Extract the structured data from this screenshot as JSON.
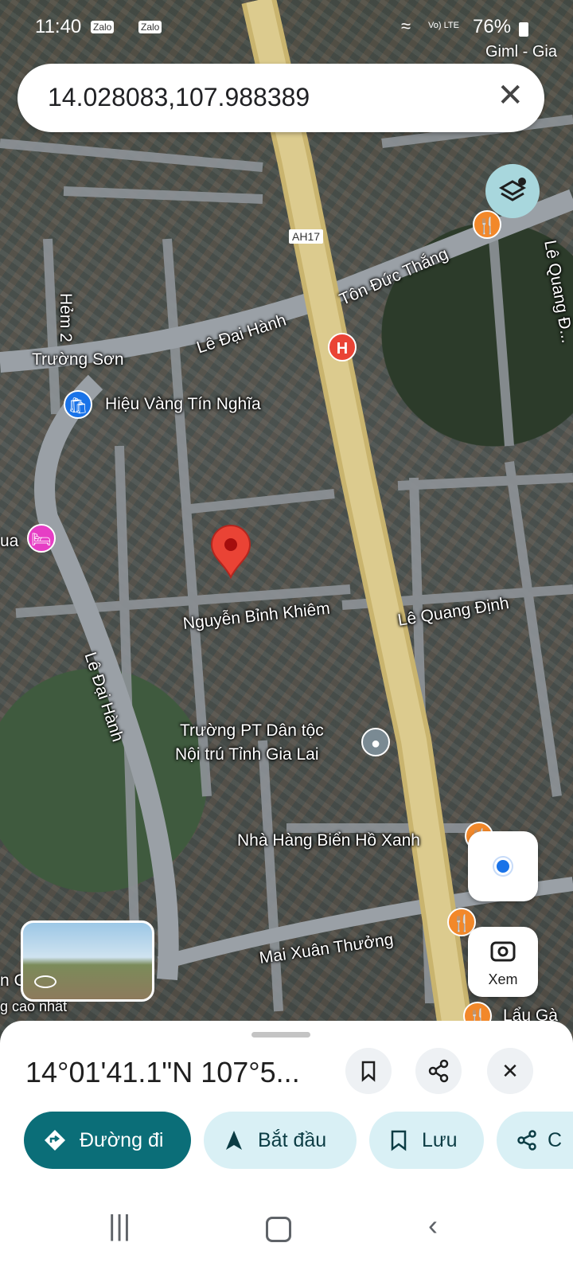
{
  "status_bar": {
    "time": "11:40",
    "app_icons": [
      "Zalo",
      "Zalo"
    ],
    "network": "Vo) LTE",
    "battery": "76%",
    "corner_place": "Giml - Gia"
  },
  "search": {
    "query": "14.028083,107.988389"
  },
  "map": {
    "road_shield": "AH17",
    "streets": [
      "Tôn Đức Thắng",
      "Lê Đại Hành",
      "Trường Sơn",
      "Hẻm 2",
      "Lê Quang Đ...",
      "Nguyễn Bỉnh Khiêm",
      "Lê Quang Định",
      "Lê Đại Hành",
      "Mai Xuân Thưởng"
    ],
    "places": {
      "jewelry": "Hiệu Vàng Tín Nghĩa",
      "hotel_partial": "ua",
      "school_line1": "Trường PT Dân tộc",
      "school_line2": "Nội trú Tỉnh Gia Lai",
      "restaurant": "Nhà Hàng Biển Hồ Xanh",
      "hotpot_partial": "Lẩu Gà",
      "partial_left": "g cao nhất",
      "partial_left_c": "n C"
    },
    "explore_label": "Xem"
  },
  "sheet": {
    "coordinates": "14°01'41.1\"N 107°5...",
    "actions": {
      "directions": "Đường đi",
      "start": "Bắt đầu",
      "save": "Lưu",
      "share": "C"
    }
  },
  "colors": {
    "primary": "#0b6e78",
    "chip_bg": "#d9f0f5",
    "marker": "#ea4335",
    "highway": "#d8c586",
    "poi_orange": "#f2882a",
    "poi_blue": "#1a73e8",
    "poi_pink": "#e63ec5"
  }
}
